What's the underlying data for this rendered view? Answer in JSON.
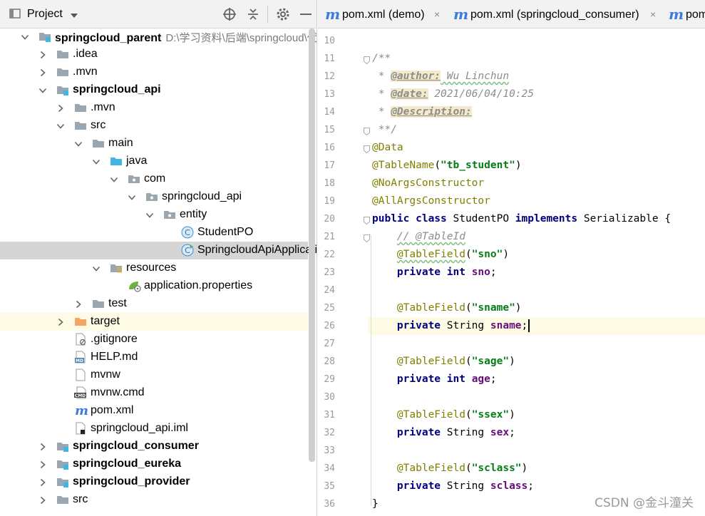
{
  "project_pane": {
    "title": "Project",
    "icons": [
      "target-icon",
      "collapse-icon",
      "gear-icon",
      "minimize-icon"
    ]
  },
  "tree": [
    {
      "name": "springcloud_parent",
      "bold": true,
      "path": "D:\\学习资料\\后端\\springcloud\\代码",
      "icon": "module-folder-icon",
      "expanded": true,
      "level": 0
    },
    {
      "name": ".idea",
      "icon": "folder-icon",
      "expanded": false,
      "level": 1
    },
    {
      "name": ".mvn",
      "icon": "folder-icon",
      "expanded": false,
      "level": 1
    },
    {
      "name": "springcloud_api",
      "bold": true,
      "icon": "module-folder-icon",
      "expanded": true,
      "level": 1
    },
    {
      "name": ".mvn",
      "icon": "folder-icon",
      "expanded": false,
      "level": 2
    },
    {
      "name": "src",
      "icon": "folder-icon",
      "expanded": true,
      "level": 2
    },
    {
      "name": "main",
      "icon": "folder-icon",
      "expanded": true,
      "level": 3
    },
    {
      "name": "java",
      "icon": "source-folder-icon",
      "expanded": true,
      "level": 4
    },
    {
      "name": "com",
      "icon": "package-icon",
      "expanded": true,
      "level": 5
    },
    {
      "name": "springcloud_api",
      "icon": "package-icon",
      "expanded": true,
      "level": 6
    },
    {
      "name": "entity",
      "icon": "package-icon",
      "expanded": true,
      "level": 7
    },
    {
      "name": "StudentPO",
      "icon": "class-icon",
      "level": 8
    },
    {
      "name": "SpringcloudApiApplication",
      "icon": "spring-class-icon",
      "level": 8,
      "selected": true
    },
    {
      "name": "resources",
      "icon": "resources-folder-icon",
      "expanded": true,
      "level": 4
    },
    {
      "name": "application.properties",
      "icon": "spring-properties-icon",
      "level": 5
    },
    {
      "name": "test",
      "icon": "folder-icon",
      "expanded": false,
      "level": 3
    },
    {
      "name": "target",
      "icon": "excluded-folder-icon",
      "expanded": false,
      "level": 2,
      "highlight": true
    },
    {
      "name": ".gitignore",
      "icon": "ignored-file-icon",
      "level": 2
    },
    {
      "name": "HELP.md",
      "icon": "markdown-file-icon",
      "level": 2
    },
    {
      "name": "mvnw",
      "icon": "file-icon",
      "level": 2
    },
    {
      "name": "mvnw.cmd",
      "icon": "cmd-file-icon",
      "level": 2
    },
    {
      "name": "pom.xml",
      "icon": "maven-icon",
      "level": 2
    },
    {
      "name": "springcloud_api.iml",
      "icon": "iml-file-icon",
      "level": 2
    },
    {
      "name": "springcloud_consumer",
      "bold": true,
      "icon": "module-folder-icon",
      "expanded": false,
      "level": 1
    },
    {
      "name": "springcloud_eureka",
      "bold": true,
      "icon": "module-folder-icon",
      "expanded": false,
      "level": 1
    },
    {
      "name": "springcloud_provider",
      "bold": true,
      "icon": "module-folder-icon",
      "expanded": false,
      "level": 1
    },
    {
      "name": "src",
      "icon": "folder-icon",
      "expanded": false,
      "level": 1
    }
  ],
  "tabs": [
    {
      "icon": "maven-icon",
      "label": "pom.xml (demo)",
      "close": "×"
    },
    {
      "icon": "maven-icon",
      "label": "pom.xml (springcloud_consumer)",
      "close": "×"
    },
    {
      "icon": "maven-icon",
      "label": "pom",
      "close": ""
    }
  ],
  "editor": {
    "first_line": 10,
    "current_line": 26,
    "lines": [
      {
        "n": 10,
        "parts": []
      },
      {
        "n": 11,
        "parts": [
          {
            "t": "/**",
            "c": "comment-plain"
          }
        ]
      },
      {
        "n": 12,
        "parts": [
          {
            "t": " * ",
            "c": "comment-plain"
          },
          {
            "t": "@author:",
            "c": "doctag"
          },
          {
            "t": " Wu Linchun",
            "c": "docval-squig"
          }
        ]
      },
      {
        "n": 13,
        "parts": [
          {
            "t": " * ",
            "c": "comment-plain"
          },
          {
            "t": "@date:",
            "c": "doctag"
          },
          {
            "t": " 2021/06/04/10:25",
            "c": "docval"
          }
        ]
      },
      {
        "n": 14,
        "parts": [
          {
            "t": " * ",
            "c": "comment-plain"
          },
          {
            "t": "@Description:",
            "c": "doctag"
          }
        ]
      },
      {
        "n": 15,
        "parts": [
          {
            "t": " **/",
            "c": "comment-plain"
          }
        ]
      },
      {
        "n": 16,
        "parts": [
          {
            "t": "@Data",
            "c": "ann"
          }
        ]
      },
      {
        "n": 17,
        "parts": [
          {
            "t": "@TableName",
            "c": "ann"
          },
          {
            "t": "(",
            "c": ""
          },
          {
            "t": "\"tb_student\"",
            "c": "str"
          },
          {
            "t": ")",
            "c": ""
          }
        ]
      },
      {
        "n": 18,
        "parts": [
          {
            "t": "@NoArgsConstructor",
            "c": "ann"
          }
        ]
      },
      {
        "n": 19,
        "parts": [
          {
            "t": "@AllArgsConstructor",
            "c": "ann"
          }
        ]
      },
      {
        "n": 20,
        "parts": [
          {
            "t": "public class",
            "c": "kw"
          },
          {
            "t": " StudentPO ",
            "c": ""
          },
          {
            "t": "implements",
            "c": "kw"
          },
          {
            "t": " Serializable {",
            "c": ""
          }
        ]
      },
      {
        "n": 21,
        "parts": [
          {
            "t": "    ",
            "c": ""
          },
          {
            "t": "// @TableId",
            "c": "comment-squig"
          }
        ]
      },
      {
        "n": 22,
        "parts": [
          {
            "t": "    ",
            "c": ""
          },
          {
            "t": "@TableField",
            "c": "ann-squig"
          },
          {
            "t": "(",
            "c": ""
          },
          {
            "t": "\"sno\"",
            "c": "str"
          },
          {
            "t": ")",
            "c": ""
          }
        ]
      },
      {
        "n": 23,
        "parts": [
          {
            "t": "    ",
            "c": ""
          },
          {
            "t": "private int",
            "c": "kw"
          },
          {
            "t": " ",
            "c": ""
          },
          {
            "t": "sno",
            "c": "field"
          },
          {
            "t": ";",
            "c": ""
          }
        ]
      },
      {
        "n": 24,
        "parts": []
      },
      {
        "n": 25,
        "parts": [
          {
            "t": "    ",
            "c": ""
          },
          {
            "t": "@TableField",
            "c": "ann"
          },
          {
            "t": "(",
            "c": ""
          },
          {
            "t": "\"sname\"",
            "c": "str"
          },
          {
            "t": ")",
            "c": ""
          }
        ]
      },
      {
        "n": 26,
        "parts": [
          {
            "t": "    ",
            "c": ""
          },
          {
            "t": "private",
            "c": "kw"
          },
          {
            "t": " String ",
            "c": ""
          },
          {
            "t": "sname",
            "c": "field"
          },
          {
            "t": ";",
            "c": ""
          }
        ],
        "caret": true
      },
      {
        "n": 27,
        "parts": []
      },
      {
        "n": 28,
        "parts": [
          {
            "t": "    ",
            "c": ""
          },
          {
            "t": "@TableField",
            "c": "ann"
          },
          {
            "t": "(",
            "c": ""
          },
          {
            "t": "\"sage\"",
            "c": "str"
          },
          {
            "t": ")",
            "c": ""
          }
        ]
      },
      {
        "n": 29,
        "parts": [
          {
            "t": "    ",
            "c": ""
          },
          {
            "t": "private int",
            "c": "kw"
          },
          {
            "t": " ",
            "c": ""
          },
          {
            "t": "age",
            "c": "field"
          },
          {
            "t": ";",
            "c": ""
          }
        ]
      },
      {
        "n": 30,
        "parts": []
      },
      {
        "n": 31,
        "parts": [
          {
            "t": "    ",
            "c": ""
          },
          {
            "t": "@TableField",
            "c": "ann"
          },
          {
            "t": "(",
            "c": ""
          },
          {
            "t": "\"ssex\"",
            "c": "str"
          },
          {
            "t": ")",
            "c": ""
          }
        ]
      },
      {
        "n": 32,
        "parts": [
          {
            "t": "    ",
            "c": ""
          },
          {
            "t": "private",
            "c": "kw"
          },
          {
            "t": " String ",
            "c": ""
          },
          {
            "t": "sex",
            "c": "field"
          },
          {
            "t": ";",
            "c": ""
          }
        ]
      },
      {
        "n": 33,
        "parts": []
      },
      {
        "n": 34,
        "parts": [
          {
            "t": "    ",
            "c": ""
          },
          {
            "t": "@TableField",
            "c": "ann"
          },
          {
            "t": "(",
            "c": ""
          },
          {
            "t": "\"sclass\"",
            "c": "str"
          },
          {
            "t": ")",
            "c": ""
          }
        ]
      },
      {
        "n": 35,
        "parts": [
          {
            "t": "    ",
            "c": ""
          },
          {
            "t": "private",
            "c": "kw"
          },
          {
            "t": " String ",
            "c": ""
          },
          {
            "t": "sclass",
            "c": "field"
          },
          {
            "t": ";",
            "c": ""
          }
        ]
      },
      {
        "n": 36,
        "parts": [
          {
            "t": "}",
            "c": ""
          }
        ]
      }
    ]
  },
  "watermark": "CSDN @金斗潼关",
  "colors": {
    "keyword": "#000080",
    "annotation": "#808000",
    "string": "#067d17",
    "field": "#660e7a",
    "comment": "#8c8c8c",
    "accent": "#3b7be0"
  }
}
